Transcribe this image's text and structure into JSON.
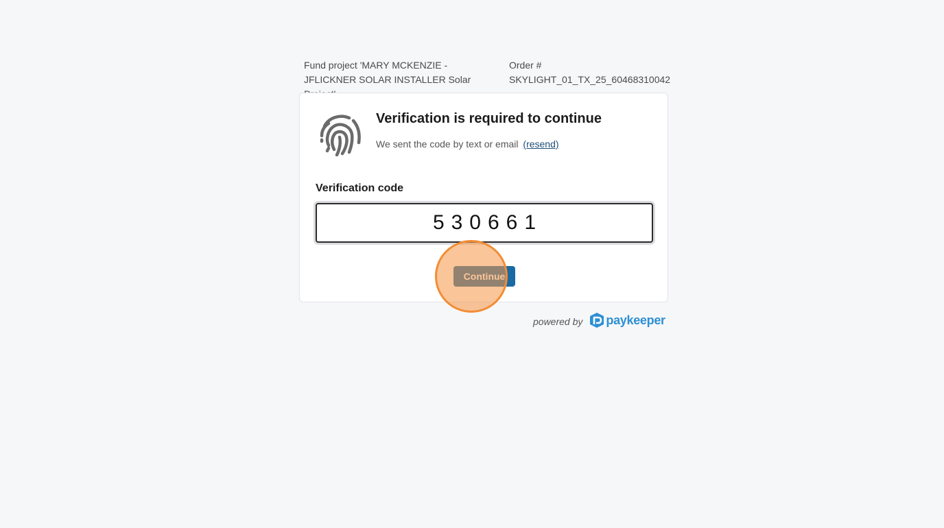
{
  "header": {
    "project_text": "Fund project 'MARY MCKENZIE - JFLICKNER SOLAR INSTALLER Solar Project'",
    "order_label": "Order #",
    "order_number": "SKYLIGHT_01_TX_25_60468310042"
  },
  "card": {
    "icon": "fingerprint-icon",
    "title": "Verification is required to continue",
    "subtitle": "We sent the code by text or email",
    "resend_link": "(resend)",
    "code_label": "Verification code",
    "code_value": "530661",
    "continue_label": "Continue"
  },
  "footer": {
    "powered_by": "powered by",
    "brand": "paykeeper",
    "brand_icon": "paykeeper-logo-icon"
  },
  "colors": {
    "accent": "#1a6aa3",
    "brand": "#2d8fd5",
    "link": "#1f4e79",
    "background": "#f6f7f9"
  }
}
